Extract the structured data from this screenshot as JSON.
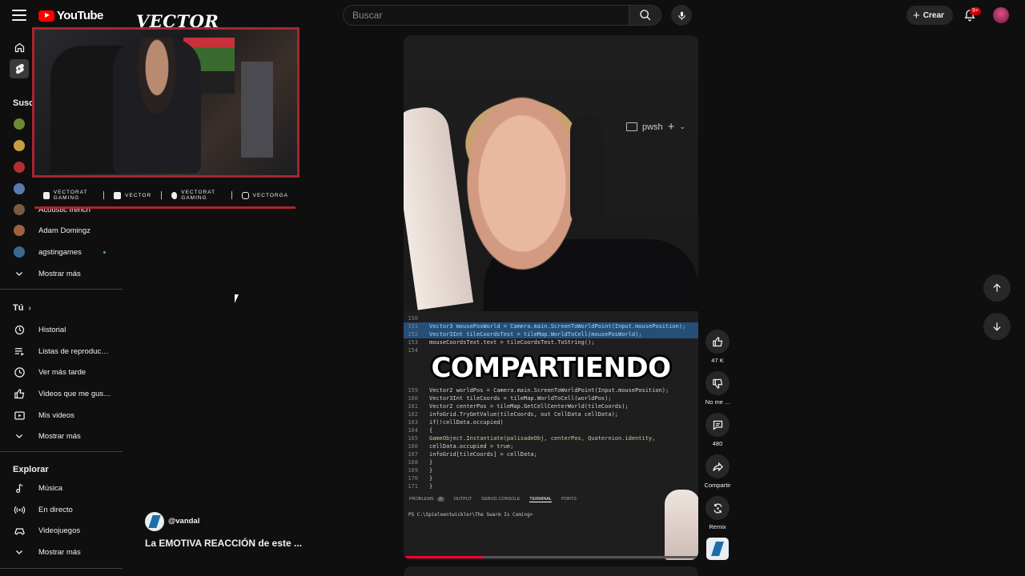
{
  "header": {
    "logo_text": "YouTube",
    "search_placeholder": "Buscar",
    "create_label": "Crear",
    "notification_badge": "9+"
  },
  "sidebar": {
    "subscriptions_heading": "Suscripciones",
    "subscriptions": [
      {
        "label": "",
        "color": "#6a8a30"
      },
      {
        "label": "",
        "color": "#c8a040"
      },
      {
        "label": "",
        "color": "#b03030"
      },
      {
        "label": "",
        "color": "#5a7ab0"
      },
      {
        "label": "Acoustic french",
        "color": "#7a5a40"
      },
      {
        "label": "Adam Domingz",
        "color": "#a06040"
      },
      {
        "label": "agstingames",
        "color": "#3a6a90"
      }
    ],
    "subs_more": "Mostrar más",
    "you_heading": "Tú",
    "you_items": [
      {
        "label": "Historial",
        "icon": "history-icon"
      },
      {
        "label": "Listas de reproducción",
        "icon": "playlists-icon"
      },
      {
        "label": "Ver más tarde",
        "icon": "watch-later-icon"
      },
      {
        "label": "Videos que me gustan",
        "icon": "liked-icon"
      },
      {
        "label": "Mis videos",
        "icon": "my-videos-icon"
      }
    ],
    "you_more": "Mostrar más",
    "explore_heading": "Explorar",
    "explore_items": [
      {
        "label": "Música",
        "icon": "music-icon"
      },
      {
        "label": "En directo",
        "icon": "live-icon"
      },
      {
        "label": "Videojuegos",
        "icon": "gaming-icon"
      }
    ],
    "explore_more": "Mostrar más"
  },
  "stream_overlay": {
    "title": "VECTOR",
    "socials": [
      "VECTORAT GAMING",
      "VECTOR",
      "VECTORAT GAMING",
      "VECTORGA"
    ]
  },
  "short": {
    "channel_handle": "@vandal",
    "title": "La EMOTIVA REACCIÓN de este ...",
    "caption": "COMPARTIENDO",
    "terminal_label": "pwsh",
    "terminal_prompt": "PS C:\\Spieleentwickler\\The Swarm Is Coming>",
    "terminal_tabs": [
      "PROBLEMS",
      "6",
      "OUTPUT",
      "DEBUG CONSOLE",
      "TERMINAL",
      "PORTS"
    ],
    "progress": 0.27,
    "code_lines": [
      {
        "n": "150",
        "t": "",
        "sel": false
      },
      {
        "n": "151",
        "t": "Vector3 mousePosWorld = Camera.main.ScreenToWorldPoint(Input.mousePosition);",
        "sel": true
      },
      {
        "n": "152",
        "t": "Vector3Int tileCoordsTest = tileMap.WorldToCell(mousePosWorld);",
        "sel": true
      },
      {
        "n": "153",
        "t": "mouseCoordsText.text = tileCoordsTest.ToString();",
        "sel": false
      },
      {
        "n": "154",
        "t": "",
        "sel": false
      },
      {
        "n": "159",
        "t": "    Vector2 worldPos = Camera.main.ScreenToWorldPoint(Input.mousePosition);",
        "sel": false
      },
      {
        "n": "160",
        "t": "    Vector3Int tileCoords = tileMap.WorldToCell(worldPos);",
        "sel": false
      },
      {
        "n": "161",
        "t": "    Vector2 centerPos = tileMap.GetCellCenterWorld(tileCoords);",
        "sel": false
      },
      {
        "n": "162",
        "t": "    infoGrid.TryGetValue(tileCoords, out CellData cellData);",
        "sel": false
      },
      {
        "n": "163",
        "t": "    if(!cellData.occupied)",
        "sel": false
      },
      {
        "n": "164",
        "t": "    {",
        "sel": false
      },
      {
        "n": "165",
        "t": "        GameObject.Instantiate(palisadeObj, centerPos, Quaternion.identity,",
        "sel": false
      },
      {
        "n": "166",
        "t": "        cellData.occupied = true;",
        "sel": false
      },
      {
        "n": "167",
        "t": "        infoGrid[tileCoords] = cellData;",
        "sel": false
      },
      {
        "n": "168",
        "t": "    }",
        "sel": false
      },
      {
        "n": "169",
        "t": "  }",
        "sel": false
      },
      {
        "n": "170",
        "t": "  }",
        "sel": false
      },
      {
        "n": "171",
        "t": "}",
        "sel": false
      }
    ]
  },
  "actions": {
    "like_count": "47 K",
    "dislike_label": "No me ...",
    "comments_count": "480",
    "share_label": "Compartir",
    "remix_label": "Remix"
  },
  "colors": {
    "brand_red": "#ff0000",
    "background": "#0f0f0f",
    "overlay_border": "#a8262c"
  }
}
